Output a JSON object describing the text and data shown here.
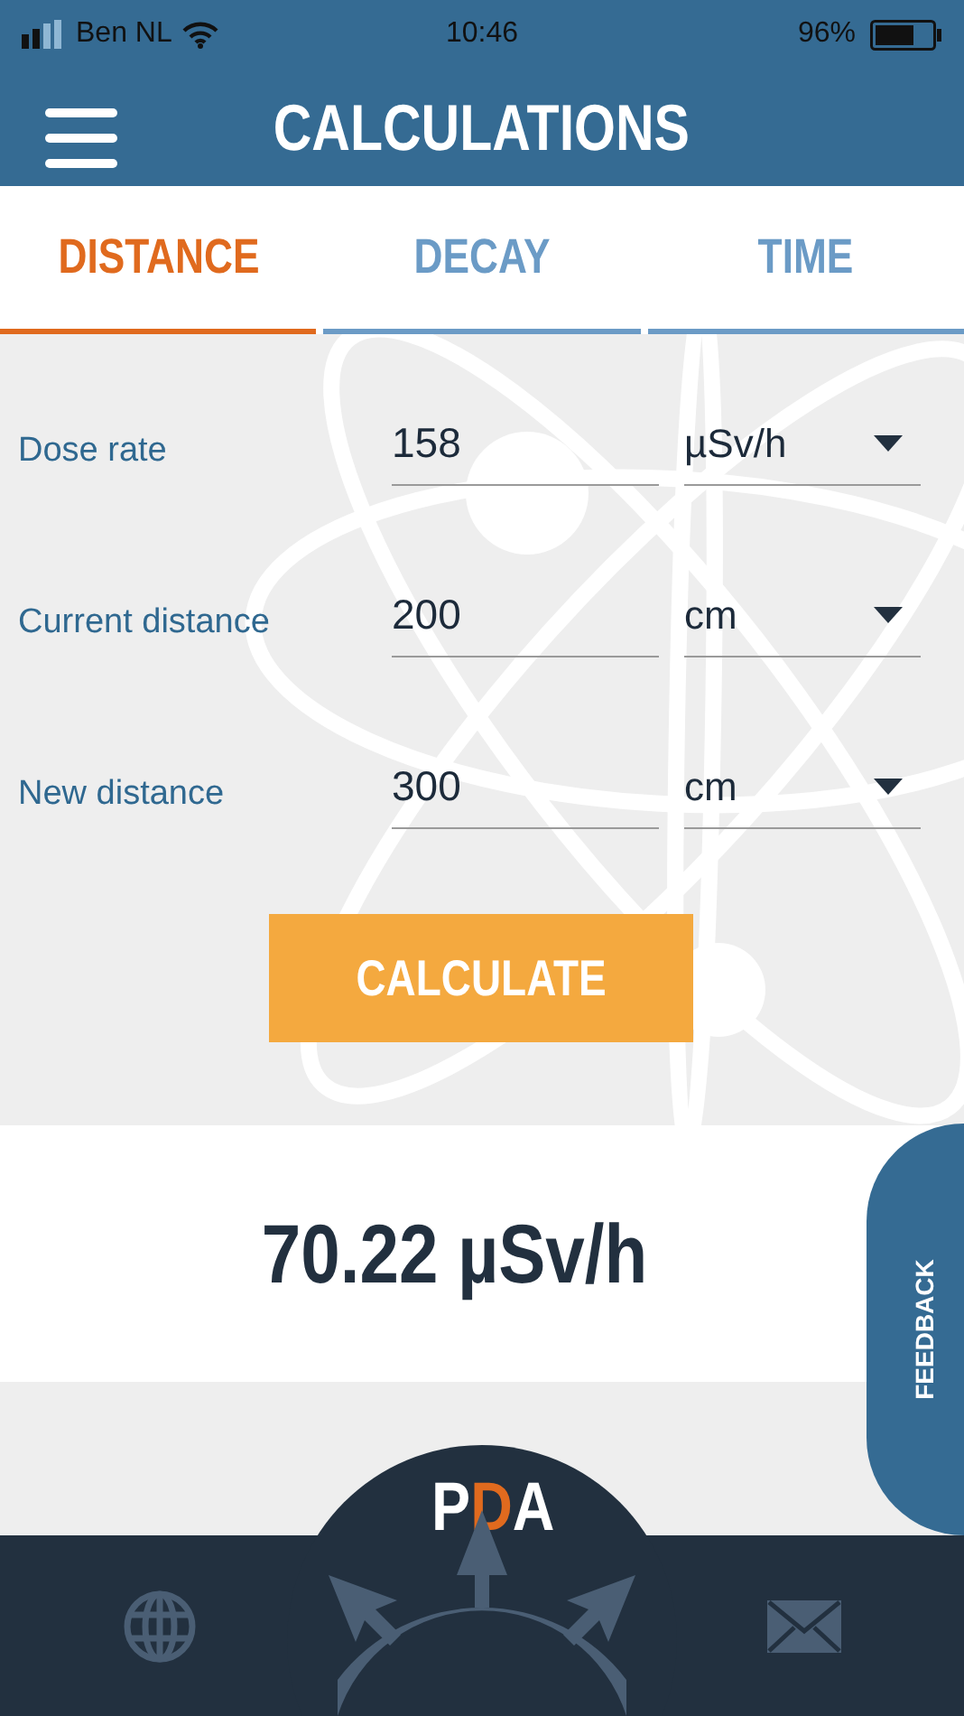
{
  "status_bar": {
    "carrier": "Ben NL",
    "time": "10:46",
    "battery": "96%"
  },
  "header": {
    "title": "CALCULATIONS"
  },
  "tabs": [
    {
      "label": "DISTANCE",
      "selected": true
    },
    {
      "label": "DECAY",
      "selected": false
    },
    {
      "label": "TIME",
      "selected": false
    }
  ],
  "form": {
    "rows": [
      {
        "label": "Dose rate",
        "value": "158",
        "unit": "µSv/h"
      },
      {
        "label": "Current distance",
        "value": "200",
        "unit": "cm"
      },
      {
        "label": "New distance",
        "value": "300",
        "unit": "cm"
      }
    ],
    "button": "CALCULATE"
  },
  "result": "70.22 µSv/h",
  "feedback_tab": "FEEDBACK",
  "logo": {
    "letters": [
      {
        "text": "P",
        "highlighted": false
      },
      {
        "text": "D",
        "highlighted": true
      },
      {
        "text": "A",
        "highlighted": false
      }
    ]
  }
}
